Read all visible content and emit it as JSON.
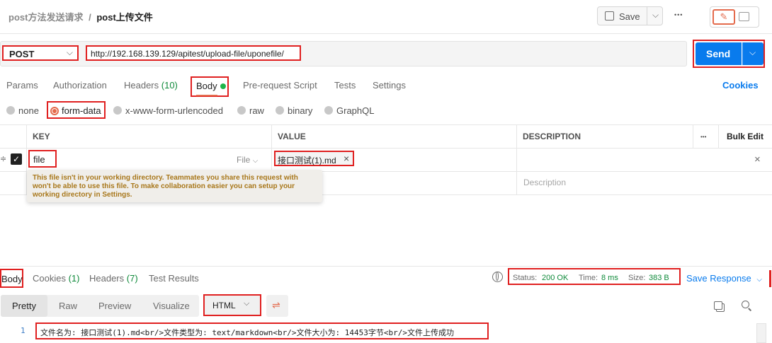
{
  "header": {
    "breadcrumb_parent": "post方法发送请求",
    "breadcrumb_sep": "/",
    "breadcrumb_current": "post上传文件",
    "save_label": "Save",
    "more_label": "•••"
  },
  "request": {
    "method": "POST",
    "url": "http://192.168.139.129/apitest/upload-file/uponefile/",
    "send_label": "Send"
  },
  "request_tabs": {
    "params": "Params",
    "authorization": "Authorization",
    "headers": "Headers",
    "headers_count": "(10)",
    "body": "Body",
    "prerequest": "Pre-request Script",
    "tests": "Tests",
    "settings": "Settings",
    "cookies": "Cookies"
  },
  "body_types": {
    "none": "none",
    "form_data": "form-data",
    "urlencoded": "x-www-form-urlencoded",
    "raw": "raw",
    "binary": "binary",
    "graphql": "GraphQL"
  },
  "table": {
    "col_key": "KEY",
    "col_value": "VALUE",
    "col_description": "DESCRIPTION",
    "more": "•••",
    "bulk_edit": "Bulk Edit",
    "row_key": "file",
    "row_type": "File",
    "row_value": "接口测试(1).md",
    "row_value_remove": "×",
    "row_delete": "×",
    "desc_placeholder": "Description",
    "tooltip": "This file isn't in your working directory. Teammates you share this request with won't be able to use this file. To make collaboration easier you can setup your working directory in Settings."
  },
  "response_tabs": {
    "body": "Body",
    "cookies": "Cookies",
    "cookies_count": "(1)",
    "headers": "Headers",
    "headers_count": "(7)",
    "test_results": "Test Results"
  },
  "response_status": {
    "status_label": "Status:",
    "status_value": "200 OK",
    "time_label": "Time:",
    "time_value": "8 ms",
    "size_label": "Size:",
    "size_value": "383 B",
    "save_response": "Save Response"
  },
  "response_view": {
    "pretty": "Pretty",
    "raw": "Raw",
    "preview": "Preview",
    "visualize": "Visualize",
    "format": "HTML"
  },
  "response_body": {
    "line_number": "1",
    "content": "文件名为: 接口测试(1).md<br/>文件类型为: text/markdown<br/>文件大小为: 14453字节<br/>文件上传成功"
  },
  "colors": {
    "accent_blue": "#097bed",
    "highlight_red": "#e02020",
    "status_green": "#0f8a3a",
    "tooltip_bg": "#f0eeea",
    "tooltip_text": "#a8771a"
  }
}
